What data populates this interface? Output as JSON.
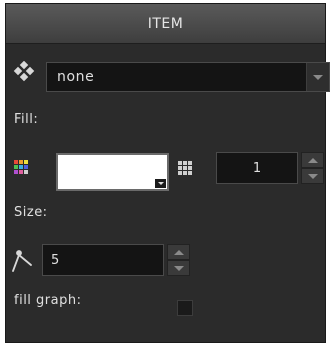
{
  "panel": {
    "title": "ITEM"
  },
  "style_select": {
    "icon": "diamond-cluster-icon",
    "value": "none"
  },
  "fill": {
    "label": "Fill:",
    "palette_icon": "color-palette-icon",
    "swatch_color": "#ffffff",
    "pattern_icon": "dot-grid-icon",
    "value": "1"
  },
  "size": {
    "label": "Size:",
    "icon": "compass-size-icon",
    "value": "5"
  },
  "fill_graph": {
    "label": "fill graph:",
    "checked": false
  }
}
